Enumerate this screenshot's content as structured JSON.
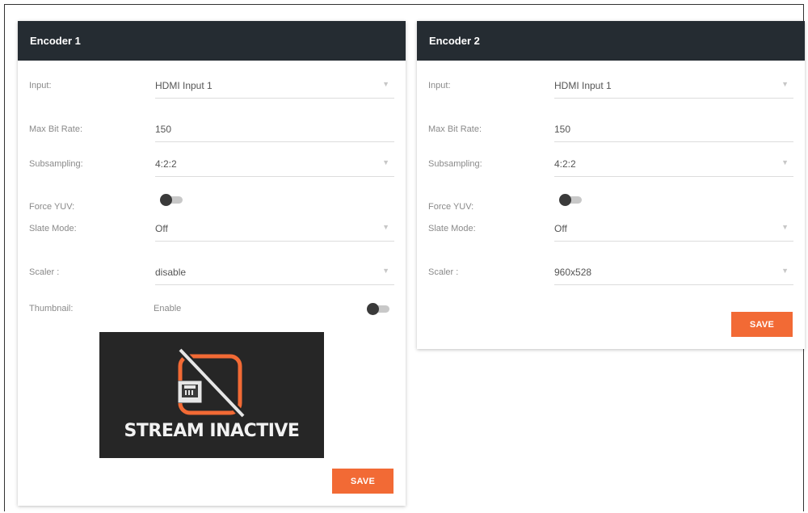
{
  "encoder1": {
    "title": "Encoder 1",
    "input": {
      "label": "Input:",
      "value": "HDMI Input 1"
    },
    "max_bit_rate": {
      "label": "Max Bit Rate:",
      "value": "150"
    },
    "subsampling": {
      "label": "Subsampling:",
      "value": "4:2:2"
    },
    "force_yuv": {
      "label": "Force YUV:",
      "enabled": false
    },
    "slate_mode": {
      "label": "Slate Mode:",
      "value": "Off"
    },
    "scaler": {
      "label": "Scaler :",
      "value": "disable"
    },
    "thumbnail": {
      "label": "Thumbnail:",
      "toggle_label": "Enable",
      "enabled": false
    },
    "stream_status": "STREAM INACTIVE",
    "save_label": "SAVE"
  },
  "encoder2": {
    "title": "Encoder 2",
    "input": {
      "label": "Input:",
      "value": "HDMI Input 1"
    },
    "max_bit_rate": {
      "label": "Max Bit Rate:",
      "value": "150"
    },
    "subsampling": {
      "label": "Subsampling:",
      "value": "4:2:2"
    },
    "force_yuv": {
      "label": "Force YUV:",
      "enabled": false
    },
    "slate_mode": {
      "label": "Slate Mode:",
      "value": "Off"
    },
    "scaler": {
      "label": "Scaler :",
      "value": "960x528"
    },
    "save_label": "SAVE"
  },
  "icons": {
    "dropdown": "chevron-down-icon",
    "stream": "ethernet-port-disabled-icon"
  },
  "colors": {
    "header_bg": "#252c32",
    "accent": "#f26a35",
    "stream_bg": "#262626"
  }
}
